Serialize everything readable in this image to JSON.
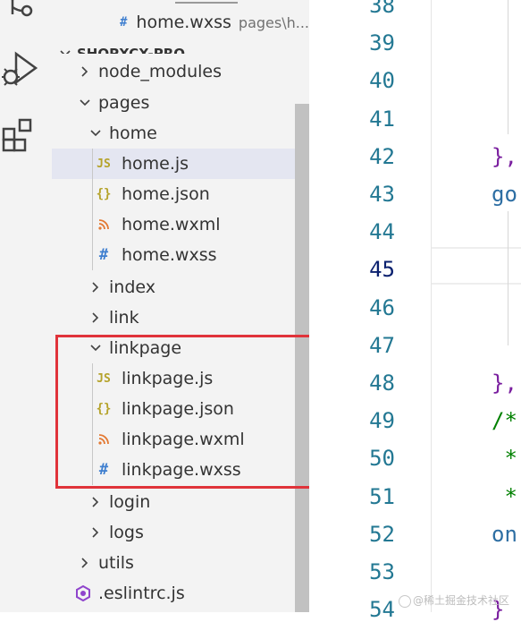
{
  "colors": {
    "js_icon": "#b5a32b",
    "json_icon": "#b5a32b",
    "wxml_icon": "#e37933",
    "wxss_icon": "#3f7fcf",
    "eslint_icon": "#8f44cc",
    "line_number": "#237893",
    "highlight_box": "#e0333a"
  },
  "activity_bar": {
    "icons": [
      "source-control-icon",
      "run-debug-icon",
      "extensions-icon"
    ]
  },
  "explorer": {
    "top_open_editor": {
      "name": "home.wxss",
      "path": "pages\\h..."
    },
    "project_title": "SHOPXCX-PRO",
    "tree": [
      {
        "label": "node_modules",
        "kind": "folder",
        "expanded": false
      },
      {
        "label": "pages",
        "kind": "folder",
        "expanded": true
      },
      {
        "label": "home",
        "kind": "folder",
        "expanded": true
      },
      {
        "label": "home.js",
        "kind": "file",
        "icon": "JS",
        "selected": true
      },
      {
        "label": "home.json",
        "kind": "file",
        "icon": "{}"
      },
      {
        "label": "home.wxml",
        "kind": "file",
        "icon": "rss"
      },
      {
        "label": "home.wxss",
        "kind": "file",
        "icon": "#"
      },
      {
        "label": "index",
        "kind": "folder",
        "expanded": false
      },
      {
        "label": "link",
        "kind": "folder",
        "expanded": false
      },
      {
        "label": "linkpage",
        "kind": "folder",
        "expanded": true
      },
      {
        "label": "linkpage.js",
        "kind": "file",
        "icon": "JS"
      },
      {
        "label": "linkpage.json",
        "kind": "file",
        "icon": "{}"
      },
      {
        "label": "linkpage.wxml",
        "kind": "file",
        "icon": "rss"
      },
      {
        "label": "linkpage.wxss",
        "kind": "file",
        "icon": "#"
      },
      {
        "label": "login",
        "kind": "folder",
        "expanded": false
      },
      {
        "label": "logs",
        "kind": "folder",
        "expanded": false
      },
      {
        "label": "utils",
        "kind": "folder",
        "expanded": false
      },
      {
        "label": ".eslintrc.js",
        "kind": "file",
        "icon": "eslint"
      }
    ]
  },
  "editor": {
    "line_numbers": [
      "38",
      "39",
      "40",
      "41",
      "42",
      "43",
      "44",
      "45",
      "46",
      "47",
      "48",
      "49",
      "50",
      "51",
      "52",
      "53",
      "54"
    ],
    "current_line": "45",
    "code_fragments": [
      {
        "line": "42",
        "text": "},"
      },
      {
        "line": "43",
        "text": "go"
      },
      {
        "line": "48",
        "text": "},"
      },
      {
        "line": "49",
        "text": "/*"
      },
      {
        "line": "50",
        "text": " *"
      },
      {
        "line": "51",
        "text": " *"
      },
      {
        "line": "52",
        "text": "on"
      },
      {
        "line": "54",
        "text": "}"
      }
    ]
  },
  "watermark": "@稀土掘金技术社区"
}
